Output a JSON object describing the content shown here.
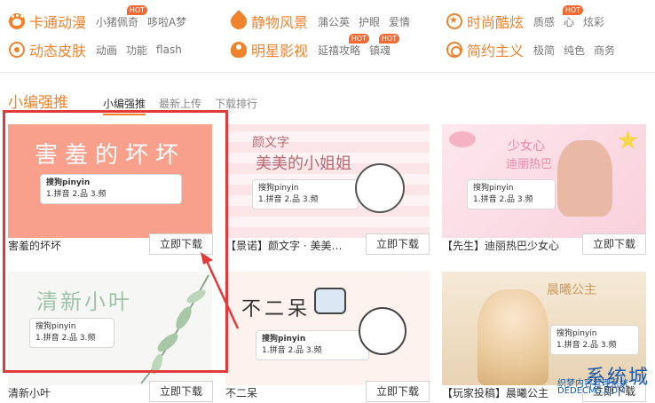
{
  "categories": [
    {
      "id": "cartoon",
      "title": "卡通动漫",
      "icon": "paw-icon",
      "links": [
        {
          "label": "小猪佩奇",
          "hot": true
        },
        {
          "label": "哆啦A梦",
          "hot": false
        }
      ]
    },
    {
      "id": "still",
      "title": "静物风景",
      "icon": "leaf-icon",
      "links": [
        {
          "label": "蒲公英",
          "hot": false
        },
        {
          "label": "护眼",
          "hot": false
        },
        {
          "label": "爱情",
          "hot": false
        }
      ]
    },
    {
      "id": "fashion",
      "title": "时尚酷炫",
      "icon": "star-icon",
      "links": [
        {
          "label": "质感",
          "hot": false
        },
        {
          "label": "心",
          "hot": true
        },
        {
          "label": "炫彩",
          "hot": false
        }
      ]
    },
    {
      "id": "dynamic",
      "title": "动态皮肤",
      "icon": "ring-icon",
      "links": [
        {
          "label": "动画",
          "hot": false
        },
        {
          "label": "功能",
          "hot": false
        },
        {
          "label": "flash",
          "hot": false
        }
      ]
    },
    {
      "id": "star",
      "title": "明星影视",
      "icon": "person-icon",
      "links": [
        {
          "label": "延禧攻略",
          "hot": true
        },
        {
          "label": "镇魂",
          "hot": true
        }
      ]
    },
    {
      "id": "simple",
      "title": "简约主义",
      "icon": "target-icon",
      "links": [
        {
          "label": "极简",
          "hot": false
        },
        {
          "label": "纯色",
          "hot": false
        },
        {
          "label": "商务",
          "hot": false
        }
      ]
    }
  ],
  "hot_badge": "HOT",
  "section": {
    "title": "小编强推",
    "tabs": [
      {
        "label": "小编强推",
        "active": true
      },
      {
        "label": "最新上传",
        "active": false
      },
      {
        "label": "下载排行",
        "active": false
      }
    ]
  },
  "download_label": "立即下载",
  "cards": [
    {
      "name": "害羞的坏坏",
      "thumb": {
        "heading": "害羞的坏坏",
        "input": "搜狗pinyin",
        "cands": "1.拼音 2.品 3.频"
      }
    },
    {
      "name": "【景诺】颜文字 · 美美…",
      "thumb": {
        "heading": "颜文字",
        "heading2": "美美的小姐姐",
        "input": "搜狗pinyin",
        "cands": "1.拼音 2.品 3.频"
      }
    },
    {
      "name": "【先生】迪丽热巴少女心",
      "thumb": {
        "heading": "少女心",
        "heading2": "迪丽热巴",
        "input": "搜狗pinyin",
        "cands": "1.拼音 2.品 3.频"
      }
    },
    {
      "name": "清新小叶",
      "thumb": {
        "heading": "清新小叶",
        "input": "搜狗pinyin",
        "cands": "1.拼音 2.品 3.频"
      }
    },
    {
      "name": "不二呆",
      "thumb": {
        "heading": "不二呆",
        "input": "搜狗pinyin",
        "cands": "1.拼音 2.品 3.频"
      }
    },
    {
      "name": "【玩家投稿】晨曦公主",
      "thumb": {
        "heading": "晨曦公主",
        "input": "搜狗pinyin",
        "cands": "1.拼音 2.品 3.频"
      }
    }
  ],
  "watermark": {
    "logo": "系统城",
    "line1": "织梦内容管理系统",
    "line2": "DEDECMS.COM"
  },
  "colors": {
    "accent": "#f0822c",
    "highlight": "#e03a3a",
    "hot": "#f16a32"
  }
}
